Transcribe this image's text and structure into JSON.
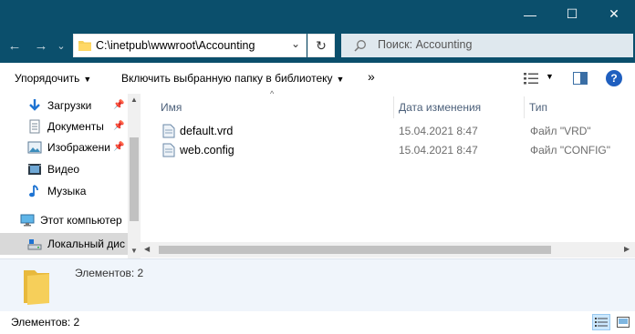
{
  "window": {
    "minimize": "—",
    "maximize": "☐",
    "close": "✕"
  },
  "nav": {
    "back": "←",
    "forward": "→",
    "recent": "⌄",
    "address": "C:\\inetpub\\wwwroot\\Accounting",
    "address_dropdown": "⌄",
    "refresh": "↻",
    "search_placeholder": "Поиск: Accounting"
  },
  "toolbar": {
    "organize": "Упорядочить",
    "include_library": "Включить выбранную папку в библиотеку",
    "more": "»",
    "help": "?"
  },
  "sidebar": {
    "items": [
      {
        "label": "Загрузки",
        "icon": "download-arrow-icon",
        "pinned": true
      },
      {
        "label": "Документы",
        "icon": "documents-icon",
        "pinned": true
      },
      {
        "label": "Изображени",
        "icon": "pictures-icon",
        "pinned": true
      },
      {
        "label": "Видео",
        "icon": "video-icon",
        "pinned": false
      },
      {
        "label": "Музыка",
        "icon": "music-icon",
        "pinned": false
      },
      {
        "label": "Этот компьютер",
        "icon": "computer-icon",
        "pinned": false
      },
      {
        "label": "Локальный дис",
        "icon": "local-disk-icon",
        "pinned": false
      }
    ]
  },
  "columns": {
    "name": "Имя",
    "date": "Дата изменения",
    "type": "Тип"
  },
  "files": [
    {
      "name": "default.vrd",
      "date": "15.04.2021 8:47",
      "type": "Файл \"VRD\""
    },
    {
      "name": "web.config",
      "date": "15.04.2021 8:47",
      "type": "Файл \"CONFIG\""
    }
  ],
  "details": {
    "count_text": "Элементов: 2"
  },
  "status": {
    "count_text": "Элементов: 2"
  },
  "colors": {
    "titlebar": "#0b4f6c",
    "selected_row": "#cce8ff",
    "details_bg": "#f0f5fb",
    "folder_yellow": "#f6cf5a"
  }
}
